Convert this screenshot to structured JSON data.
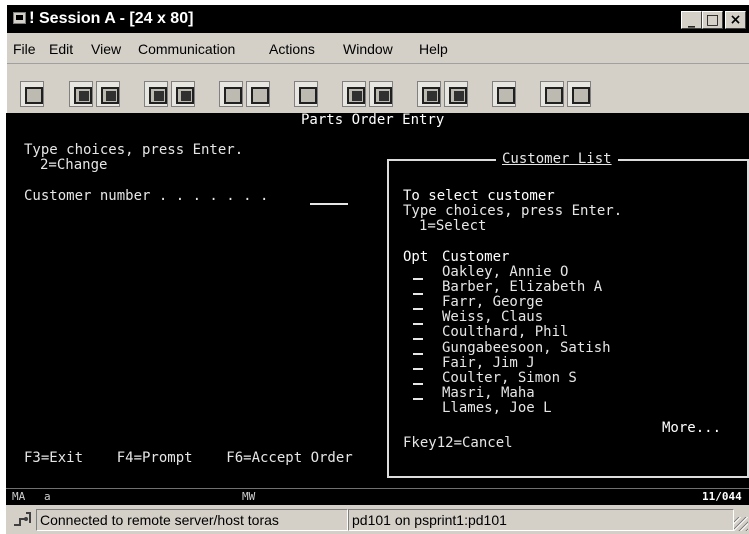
{
  "window": {
    "title": "Session A - [24 x 80]",
    "title_mark": "!",
    "controls": {
      "minimize": "_",
      "maximize": "□",
      "close": "×"
    }
  },
  "menu": [
    "File",
    "Edit",
    "View",
    "Communication",
    "Actions",
    "Window",
    "Help"
  ],
  "toolbar": {
    "icons": [
      "print-screen-icon",
      "copy-icon",
      "paste-icon",
      "send-icon",
      "receive-icon",
      "display-icon",
      "keypad-icon",
      "macro-icon",
      "record-macro-icon",
      "play-macro-icon",
      "start-icon",
      "stop-icon",
      "clipboard-icon",
      "palette-icon",
      "customize-icon"
    ]
  },
  "screen": {
    "header": "Parts Order Entry",
    "instructions": "Type choices, press Enter.",
    "option_change": "2=Change",
    "customer_number_label": "Customer number . . . . . . .",
    "fkeys": "F3=Exit    F4=Prompt    F6=Accept Order"
  },
  "popup": {
    "title": "Customer List",
    "heading": "To select customer",
    "instructions": "Type choices, press Enter.",
    "option_select": "1=Select",
    "col_opt": "Opt",
    "col_customer": "Customer",
    "customers": [
      "Oakley, Annie O",
      "Barber, Elizabeth A",
      "Farr, George",
      "Weiss, Claus",
      "Coulthard, Phil",
      "Gungabeesoon, Satish",
      "Fair, Jim J",
      "Coulter, Simon S",
      "Masri, Maha",
      "Llames, Joe L"
    ],
    "more": "More...",
    "fkey": "Fkey12=Cancel"
  },
  "oia": {
    "left": "MA",
    "session": "a",
    "mode": "MW",
    "cursor": "11/044"
  },
  "statusbar": {
    "connection": "Connected to remote server/host toras",
    "printer": "pd101 on psprint1:pd101"
  }
}
